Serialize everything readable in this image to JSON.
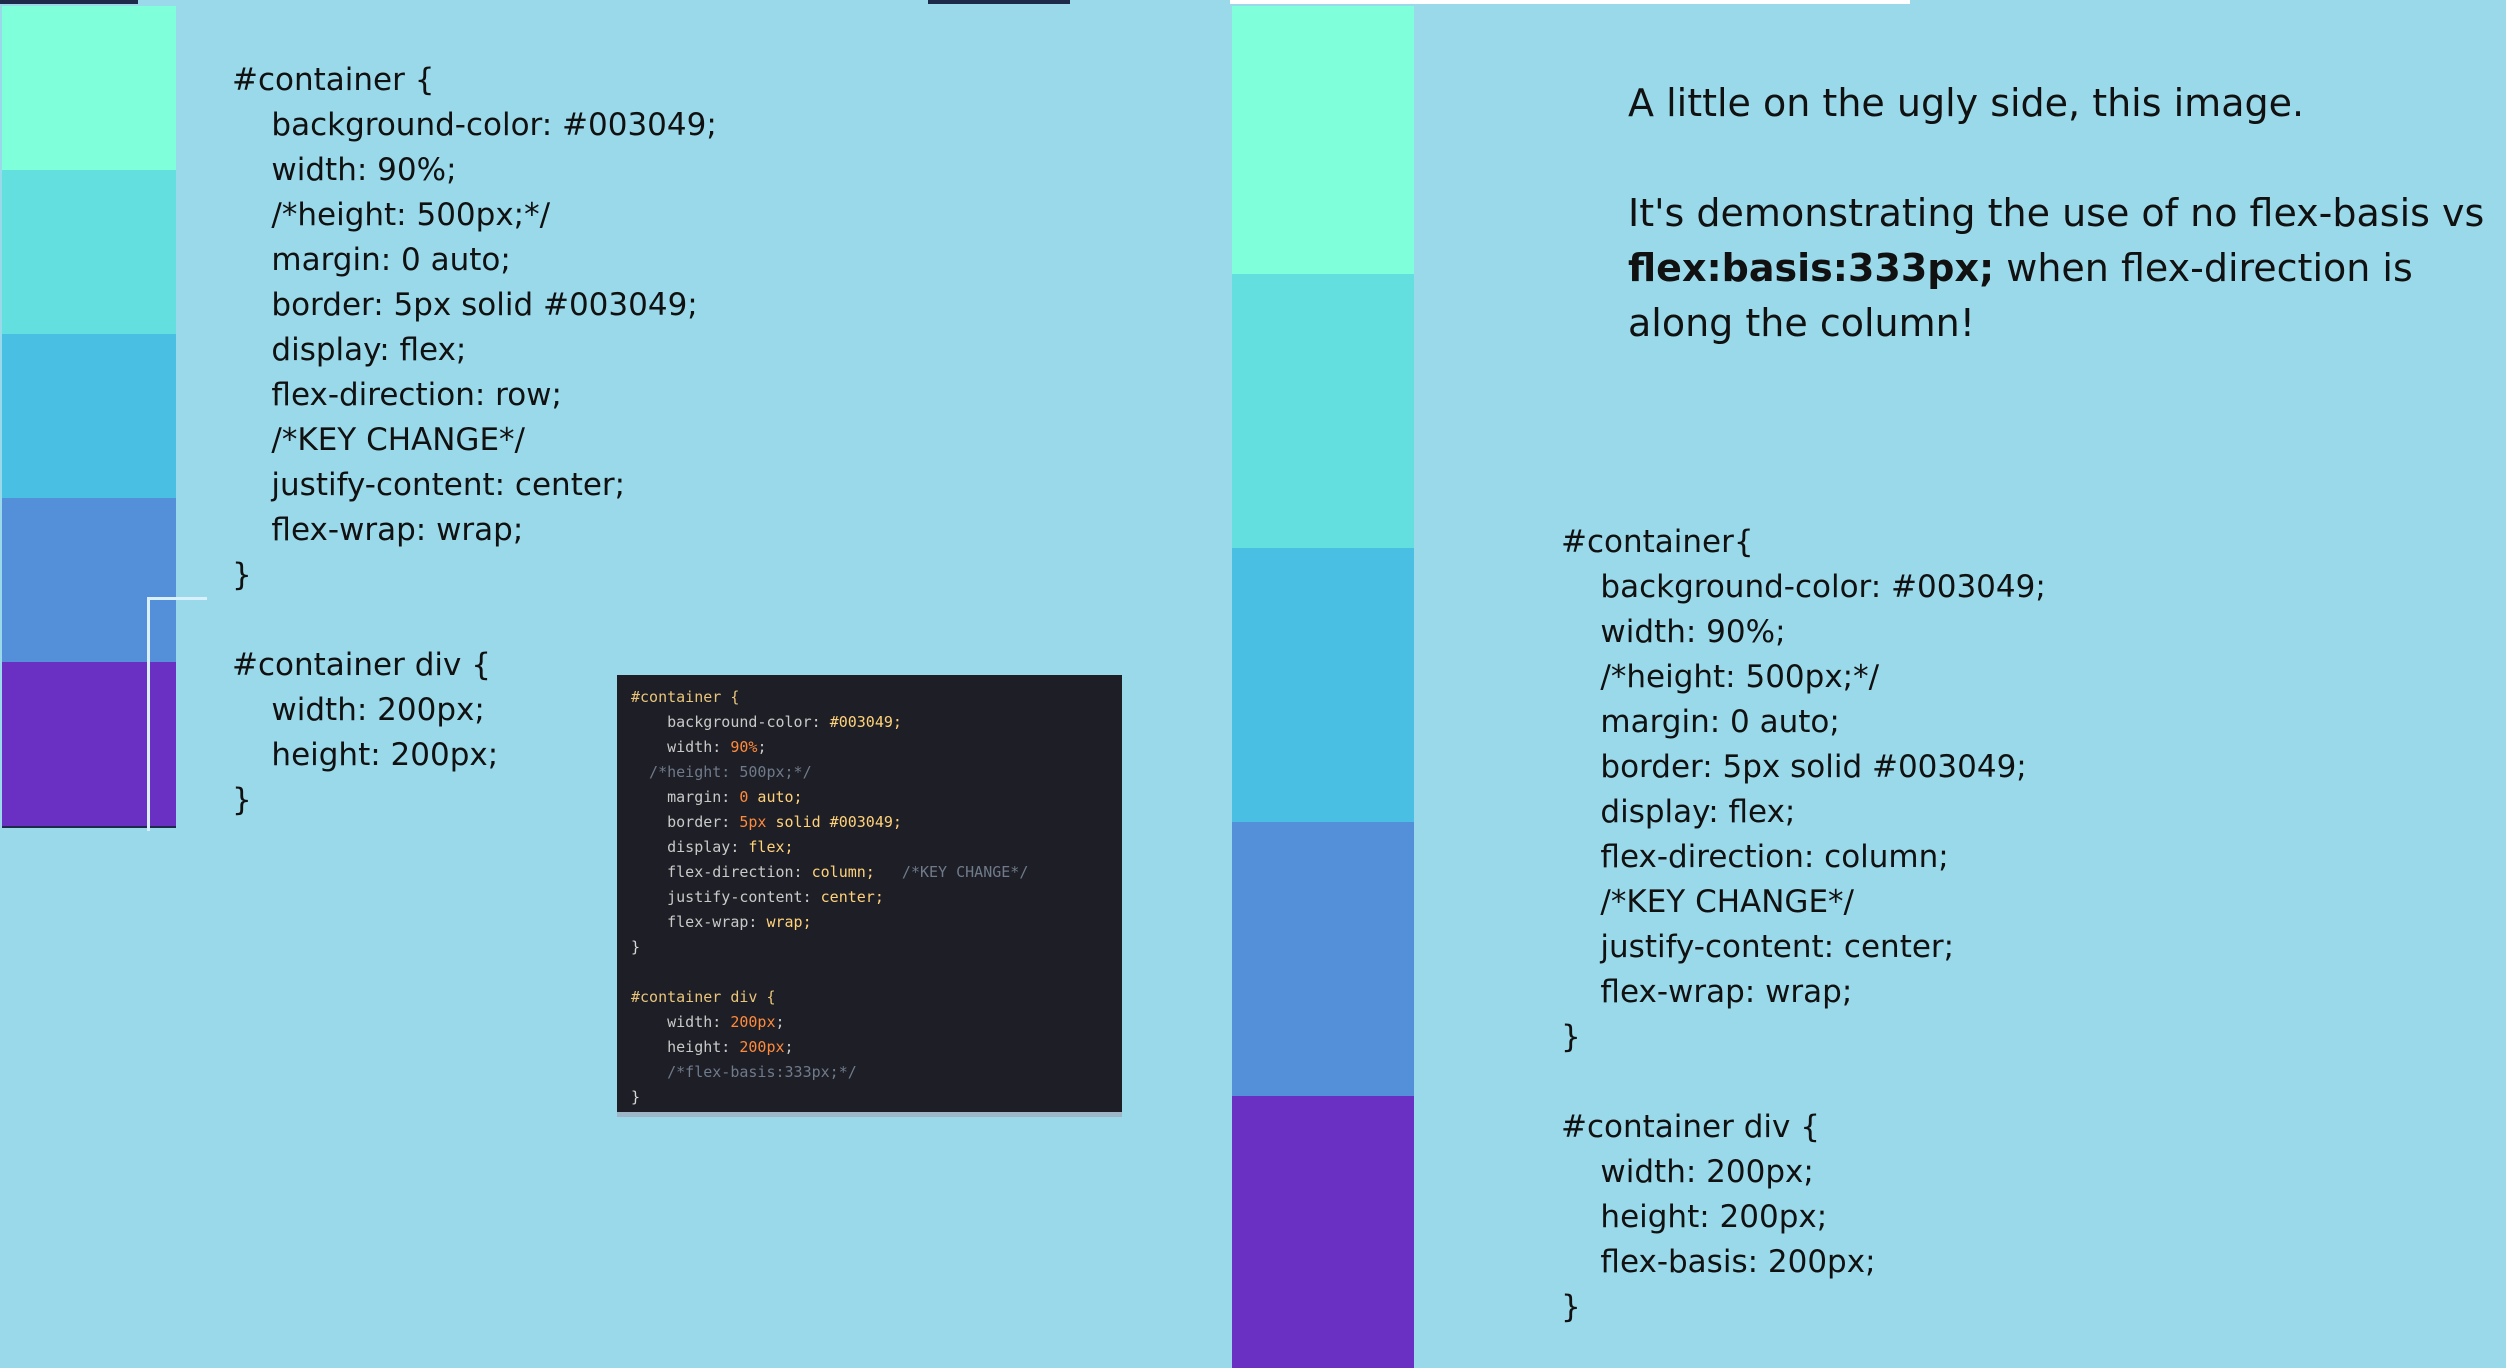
{
  "colors": {
    "background": "#9ad9ea",
    "swatches": [
      "#80ffdb",
      "#64dfdf",
      "#48bfe3",
      "#5390d9",
      "#6930c3"
    ],
    "inset_background": "#1e1f26"
  },
  "left_code": {
    "lines": [
      "#container {",
      "    background-color: #003049;",
      "    width: 90%;",
      "    /*height: 500px;*/",
      "    margin: 0 auto;",
      "    border: 5px solid #003049;",
      "    display: flex;",
      "    flex-direction: row;",
      "    /*KEY CHANGE*/",
      "    justify-content: center;",
      "    flex-wrap: wrap;",
      "}",
      "",
      "#container div {",
      "    width: 200px;",
      "    height: 200px;",
      "}"
    ]
  },
  "inset_code": {
    "lines": [
      [
        {
          "t": "#container {",
          "c": "c-sel"
        }
      ],
      [
        {
          "t": "    background-color: ",
          "c": "c-prop"
        },
        {
          "t": "#003049;",
          "c": "c-val"
        }
      ],
      [
        {
          "t": "    width: ",
          "c": "c-prop"
        },
        {
          "t": "90%",
          "c": "c-num"
        },
        {
          "t": ";",
          "c": "c-prop"
        }
      ],
      [
        {
          "t": "  /*height: 500px;*/",
          "c": "c-com"
        }
      ],
      [
        {
          "t": "    margin: ",
          "c": "c-prop"
        },
        {
          "t": "0",
          "c": "c-num"
        },
        {
          "t": " auto;",
          "c": "c-val"
        }
      ],
      [
        {
          "t": "    border: ",
          "c": "c-prop"
        },
        {
          "t": "5px",
          "c": "c-num"
        },
        {
          "t": " solid #003049;",
          "c": "c-val"
        }
      ],
      [
        {
          "t": "    display: ",
          "c": "c-prop"
        },
        {
          "t": "flex;",
          "c": "c-val"
        }
      ],
      [
        {
          "t": "    flex-direction: ",
          "c": "c-prop"
        },
        {
          "t": "column;",
          "c": "c-val"
        },
        {
          "t": "   /*KEY CHANGE*/",
          "c": "c-com"
        }
      ],
      [
        {
          "t": "    justify-content: ",
          "c": "c-prop"
        },
        {
          "t": "center;",
          "c": "c-val"
        }
      ],
      [
        {
          "t": "    flex-wrap: ",
          "c": "c-prop"
        },
        {
          "t": "wrap;",
          "c": "c-val"
        }
      ],
      [
        {
          "t": "}",
          "c": "c-brace"
        }
      ],
      [
        {
          "t": "",
          "c": "c-brace"
        }
      ],
      [
        {
          "t": "#container div {",
          "c": "c-sel"
        }
      ],
      [
        {
          "t": "    width: ",
          "c": "c-prop"
        },
        {
          "t": "200px",
          "c": "c-num"
        },
        {
          "t": ";",
          "c": "c-prop"
        }
      ],
      [
        {
          "t": "    height: ",
          "c": "c-prop"
        },
        {
          "t": "200px",
          "c": "c-num"
        },
        {
          "t": ";",
          "c": "c-prop"
        }
      ],
      [
        {
          "t": "    /*flex-basis:333px;*/",
          "c": "c-com"
        }
      ],
      [
        {
          "t": "}",
          "c": "c-brace"
        }
      ]
    ]
  },
  "note": {
    "line1": "A little on the ugly side, this image.",
    "p2_before": "It's demonstrating the use of no flex-basis vs ",
    "p2_bold": "flex:basis:333px;",
    "p2_after": " when flex-direction is along the column!"
  },
  "right_code": {
    "lines": [
      "#container{",
      "    background-color: #003049;",
      "    width: 90%;",
      "    /*height: 500px;*/",
      "    margin: 0 auto;",
      "    border: 5px solid #003049;",
      "    display: flex;",
      "    flex-direction: column;",
      "    /*KEY CHANGE*/",
      "    justify-content: center;",
      "    flex-wrap: wrap;",
      "}",
      "",
      "#container div {",
      "    width: 200px;",
      "    height: 200px;",
      "    flex-basis: 200px;",
      "}"
    ]
  }
}
